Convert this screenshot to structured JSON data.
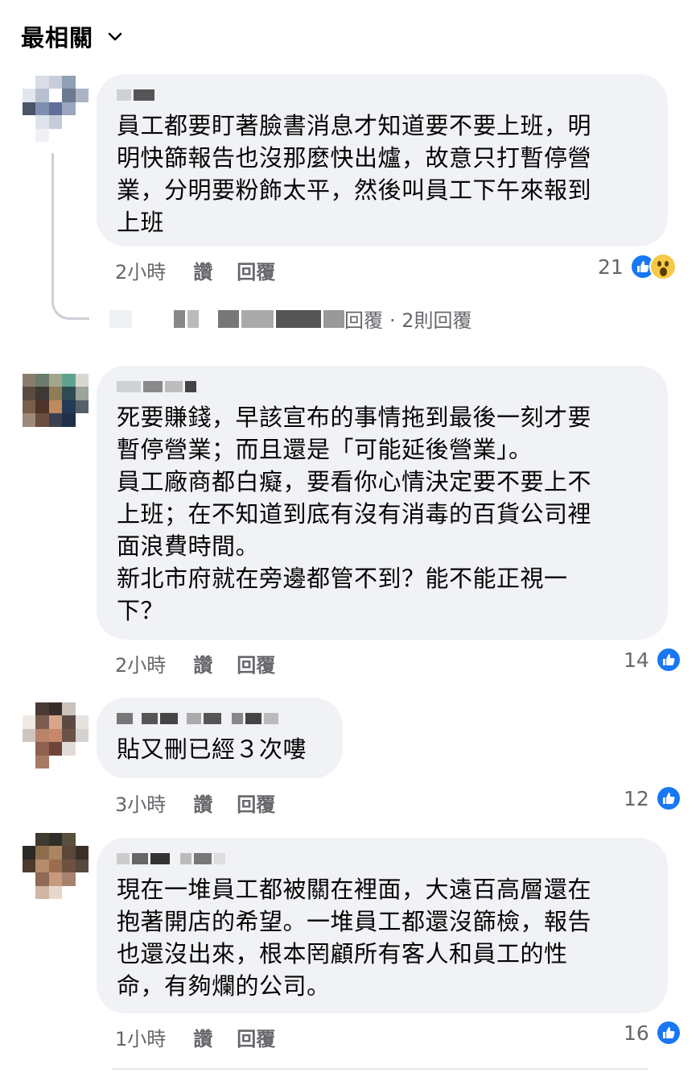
{
  "sort": {
    "label": "最相關"
  },
  "comments": [
    {
      "text": "員工都要盯著臉書消息才知道要不要上班，明\n明快篩報告也沒那麼快出爐，故意只打暫停營\n業，分明要粉飾太平，然後叫員工下午來報到\n上班",
      "time": "2小時",
      "like_label": "讚",
      "reply_label": "回覆",
      "reaction_count": "21"
    },
    {
      "text": "死要賺錢，早該宣布的事情拖到最後一刻才要\n暫停營業；而且還是「可能延後營業」。\n員工廠商都白癡，要看你心情決定要不要上不\n上班；在不知道到底有沒有消毒的百貨公司裡\n面浪費時間。\n新北市府就在旁邊都管不到？能不能正視一\n下？",
      "time": "2小時",
      "like_label": "讚",
      "reply_label": "回覆",
      "reaction_count": "14"
    },
    {
      "text": "貼又刪已經３次嘍",
      "time": "3小時",
      "like_label": "讚",
      "reply_label": "回覆",
      "reaction_count": "12"
    },
    {
      "text": "現在一堆員工都被關在裡面，大遠百高層還在\n抱著開店的希望。一堆員工都還沒篩檢，報告\n也還沒出來，根本罔顧所有客人和員工的性\n命，有夠爛的公司。",
      "time": "1小時",
      "like_label": "讚",
      "reply_label": "回覆",
      "reaction_count": "16"
    }
  ],
  "reply_summary": {
    "action": "回覆",
    "count": "· 2則回覆"
  },
  "colors": {
    "bubble": "#f0f2f5",
    "like_blue": "#1877f2",
    "meta_gray": "#65676b"
  }
}
